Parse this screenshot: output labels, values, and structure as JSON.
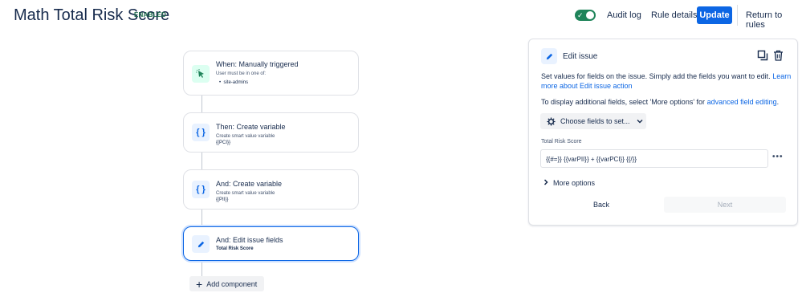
{
  "header": {
    "title": "Math Total Risk Score",
    "status_badge": "ENABLED",
    "audit_log": "Audit log",
    "rule_details": "Rule details",
    "update": "Update",
    "return": "Return to rules"
  },
  "flow": {
    "nodes": [
      {
        "title": "When: Manually triggered",
        "subtitle": "User must be in one of:",
        "bullet": "site-admins",
        "icon": "cursor-click-icon"
      },
      {
        "title": "Then: Create variable",
        "subtitle": "Create smart value variable",
        "value": "{{PCI}}",
        "icon": "braces-icon"
      },
      {
        "title": "And: Create variable",
        "subtitle": "Create smart value variable",
        "value": "{{PII}}",
        "icon": "braces-icon"
      },
      {
        "title": "And: Edit issue fields",
        "value": "Total Risk Score",
        "icon": "pencil-icon"
      }
    ],
    "add_component": "Add component"
  },
  "panel": {
    "title": "Edit issue",
    "desc_pre": "Set values for fields on the issue. Simply add the fields you want to edit.",
    "desc_link": "Learn more about Edit issue action",
    "hint_pre": "To display additional fields, select 'More options' for",
    "hint_link": "advanced field editing",
    "hint_post": ".",
    "choose_fields": "Choose fields to set...",
    "field_label": "Total Risk Score",
    "field_value": "{{#=}} {{varPII}} + {{varPCI}} {{/}}",
    "more_options": "More options",
    "back": "Back",
    "next": "Next"
  },
  "colors": {
    "accent": "#0c66e4",
    "toggle_on": "#1f845a",
    "badge_text": "#216e4e"
  }
}
